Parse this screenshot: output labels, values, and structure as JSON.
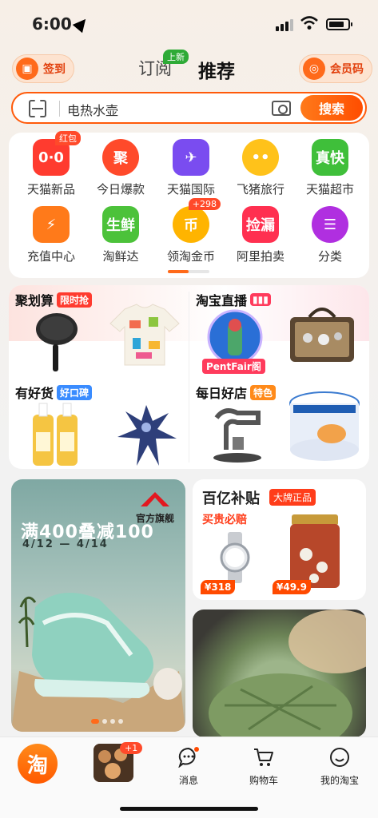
{
  "status": {
    "time": "6:00"
  },
  "header": {
    "signin_label": "签到",
    "member_label": "会员码",
    "tab_follow": "订阅",
    "tab_follow_badge": "上新",
    "tab_recommend": "推荐"
  },
  "search": {
    "placeholder": "电热水壶",
    "button": "搜索"
  },
  "quick_grid": [
    {
      "label": "天猫新品",
      "icon": "tmall-new-icon",
      "badge": "红包",
      "color": "#ff3b2f",
      "glyph": "0·0"
    },
    {
      "label": "今日爆款",
      "icon": "hot-deal-icon",
      "badge": "",
      "color": "#ff4a2a",
      "glyph": "聚"
    },
    {
      "label": "天猫国际",
      "icon": "plane-icon",
      "badge": "",
      "color": "#7a4cf0",
      "glyph": "✈"
    },
    {
      "label": "飞猪旅行",
      "icon": "fliggy-pig-icon",
      "badge": "",
      "color": "#ffc21a",
      "glyph": "••"
    },
    {
      "label": "天猫超市",
      "icon": "supermarket-icon",
      "badge": "",
      "color": "#3fbf3a",
      "glyph": "真快"
    },
    {
      "label": "充值中心",
      "icon": "recharge-icon",
      "badge": "",
      "color": "#ff7a1a",
      "glyph": "⚡"
    },
    {
      "label": "淘鲜达",
      "icon": "fresh-basket-icon",
      "badge": "",
      "color": "#4cc23a",
      "glyph": "生鲜"
    },
    {
      "label": "领淘金币",
      "icon": "gold-coin-icon",
      "badge": "+298",
      "color": "#ffb400",
      "glyph": "币"
    },
    {
      "label": "阿里拍卖",
      "icon": "auction-icon",
      "badge": "",
      "color": "#ff3050",
      "glyph": "捡漏"
    },
    {
      "label": "分类",
      "icon": "category-icon",
      "badge": "",
      "color": "#b02fe0",
      "glyph": "☰"
    }
  ],
  "channels": [
    {
      "title": "聚划算",
      "tag": "限时抢",
      "tag_color": "#ff3b2f"
    },
    {
      "title": "淘宝直播",
      "tag": "",
      "tag_color": "#ff3b5c",
      "sub": "PentFair阁"
    },
    {
      "title": "有好货",
      "tag": "好口碑",
      "tag_color": "#3a8cff"
    },
    {
      "title": "每日好店",
      "tag": "特色",
      "tag_color": "#ff8a1a"
    }
  ],
  "promo": {
    "brand": "官方旗舰",
    "title": "满400叠减100",
    "date": "4/12 — 4/14"
  },
  "subsidy": {
    "title": "百亿补贴",
    "tag": "大牌正品",
    "slogan": "买贵必赔",
    "price1": "¥318",
    "price2": "¥49.9"
  },
  "tabbar": {
    "home_glyph": "淘",
    "feed_badge": "+1",
    "messages": "消息",
    "cart": "购物车",
    "mine": "我的淘宝"
  }
}
